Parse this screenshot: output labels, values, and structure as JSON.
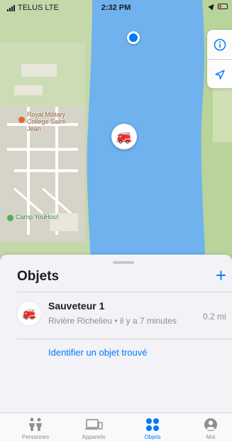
{
  "status_bar": {
    "carrier": "TELUS LTE",
    "time": "2:32 PM"
  },
  "map": {
    "pois": [
      {
        "label": "Royal Military College Saint-Jean",
        "color": "#e06a2c"
      },
      {
        "label": "Camp YouHou!",
        "color": "#4caf50"
      }
    ],
    "pin_icon": "fire-truck-icon"
  },
  "sheet": {
    "title": "Objets",
    "add_label": "+",
    "items": [
      {
        "name": "Sauveteur 1",
        "location": "Rivière Richelieu",
        "time_ago": "il y a 7 minutes",
        "distance": "0.2 mi",
        "icon": "fire-truck-icon"
      }
    ],
    "identify_link": "Identifier un objet trouvé"
  },
  "tab_bar": {
    "tabs": [
      {
        "label": "Personnes",
        "icon": "people-icon",
        "active": false
      },
      {
        "label": "Appareils",
        "icon": "devices-icon",
        "active": false
      },
      {
        "label": "Objets",
        "icon": "items-icon",
        "active": true
      },
      {
        "label": "Moi",
        "icon": "person-icon",
        "active": false
      }
    ]
  },
  "colors": {
    "accent": "#007aff",
    "water": "#6fb2ee",
    "land": "#c4d8aa"
  }
}
